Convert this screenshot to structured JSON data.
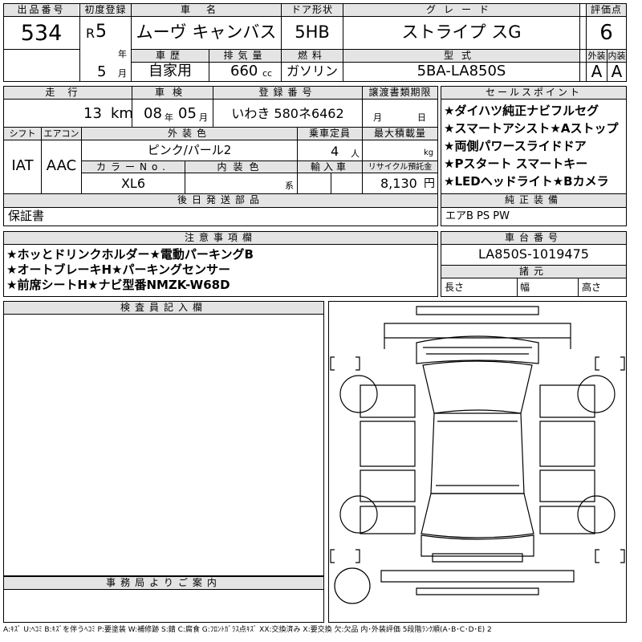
{
  "lot": {
    "header": "出品番号",
    "value": "534"
  },
  "first_reg": {
    "header": "初度登録",
    "era": "R",
    "year": "5",
    "year_unit": "年",
    "month": "5",
    "month_unit": "月"
  },
  "car_name": {
    "header": "車名",
    "value": "ムーヴ キャンバス"
  },
  "door": {
    "header": "ドア形状",
    "value": "5HB"
  },
  "grade": {
    "header": "グレード",
    "value": "ストライプ スG"
  },
  "score": {
    "header": "評価点",
    "value": "6"
  },
  "history": {
    "header": "車歴",
    "value": "自家用"
  },
  "displacement": {
    "header": "排気量",
    "value": "660",
    "unit": "cc"
  },
  "fuel": {
    "header": "燃料",
    "value": "ガソリン"
  },
  "model_type": {
    "header": "型式",
    "value": "5BA-LA850S"
  },
  "exterior_grade": {
    "header": "外装",
    "value": "A"
  },
  "interior_grade": {
    "header": "内装",
    "value": "A"
  },
  "mileage": {
    "header": "走行",
    "value": "13",
    "unit": "km"
  },
  "inspection": {
    "header": "車検",
    "year": "08",
    "year_unit": "年",
    "month": "05",
    "month_unit": "月"
  },
  "plate": {
    "header": "登録番号",
    "value": "いわき 580ネ6462"
  },
  "transfer": {
    "header": "譲渡書類期限",
    "month_unit": "月",
    "day_unit": "日"
  },
  "shift": {
    "header": "シフト",
    "value": "IAT"
  },
  "aircon": {
    "header": "エアコン",
    "value": "AAC"
  },
  "color": {
    "header": "外装色",
    "value": "ピンク/パール2"
  },
  "capacity": {
    "header": "乗車定員",
    "value": "4",
    "unit": "人"
  },
  "max_load": {
    "header": "最大積載量",
    "unit": "kg"
  },
  "color_no": {
    "header": "カラーNo.",
    "value": "XL6"
  },
  "interior_color": {
    "header": "内装色",
    "unit": "系"
  },
  "import_car": {
    "header": "輸入車"
  },
  "recycle": {
    "header": "リサイクル預託金",
    "value": "8,130",
    "unit": "円"
  },
  "selling_points": {
    "header": "セールスポイント",
    "lines": [
      "★ダイハツ純正ナビフルセグ",
      "★スマートアシスト★Aストップ",
      "★両側パワースライドドア",
      "★Pスタート スマートキー",
      "★LEDヘッドライト★Bカメラ"
    ]
  },
  "later_parts": {
    "header": "後日発送部品",
    "value": "保証書"
  },
  "standard_equipment": {
    "header": "純正装備",
    "value": "エアB PS PW"
  },
  "notes": {
    "header": "注意事項欄",
    "lines": [
      "★ホッとドリンクホルダー★電動パーキングB",
      "★オートブレーキH★パーキングセンサー",
      "★前席シートH★ナビ型番NMZK-W68D"
    ]
  },
  "chassis": {
    "header": "車台番号",
    "value": "LA850S-1019475"
  },
  "dimensions": {
    "header": "諸元",
    "length": "長さ",
    "width": "幅",
    "height": "高さ"
  },
  "inspector": {
    "header": "検査員記入欄"
  },
  "office": {
    "header": "事務局よりご案内"
  },
  "legend": "A:ｷｽﾞ U:ﾍｺﾐ B:ｷｽﾞを伴うﾍｺﾐ P:要塗装 W:補修跡 S:錆 C:腐食 G:ﾌﾛﾝﾄｶﾞﾗｽ点ｷｽﾞ XX:交換済み X:要交換 欠:欠品 内･外装評価 5段階ﾗﾝｸ順(A･B･C･D･E) 2"
}
